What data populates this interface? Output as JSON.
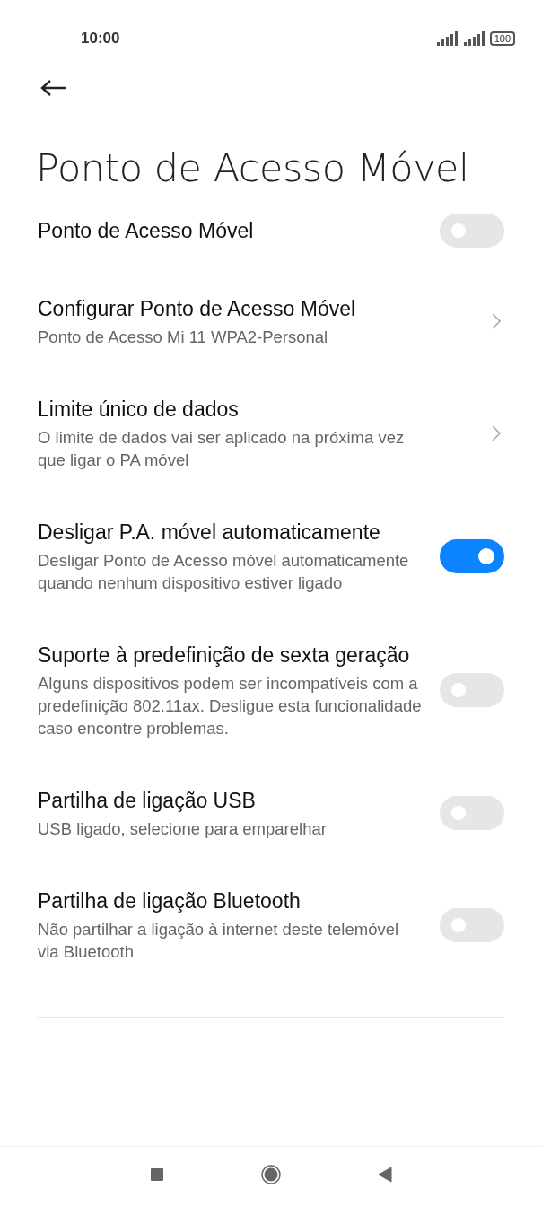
{
  "status_bar": {
    "time": "10:00",
    "battery": "100"
  },
  "title": "Ponto de Acesso Móvel",
  "settings": [
    {
      "kind": "toggle",
      "title": "Ponto de Acesso Móvel",
      "on": false
    },
    {
      "kind": "link",
      "title": "Configurar Ponto de Acesso Móvel",
      "subtitle": "Ponto de Acesso Mi 11 WPA2-Personal"
    },
    {
      "kind": "link",
      "title": "Limite único de dados",
      "subtitle": "O limite de dados vai ser aplicado na próxima vez que ligar o PA móvel"
    },
    {
      "kind": "toggle",
      "title": "Desligar P.A. móvel automaticamente",
      "subtitle": "Desligar Ponto de Acesso móvel automaticamente quando nenhum dispositivo estiver ligado",
      "on": true
    },
    {
      "kind": "toggle",
      "title": "Suporte à predefinição de sexta geração",
      "subtitle": "Alguns dispositivos podem ser incompatíveis com a predefinição 802.11ax. Desligue esta funcionalidade caso encontre problemas.",
      "on": false
    },
    {
      "kind": "toggle",
      "title": "Partilha de ligação USB",
      "subtitle": "USB ligado, selecione para emparelhar",
      "on": false
    },
    {
      "kind": "toggle",
      "title": "Partilha de ligação Bluetooth",
      "subtitle": "Não partilhar a ligação à internet deste telemóvel via Bluetooth",
      "on": false
    }
  ]
}
